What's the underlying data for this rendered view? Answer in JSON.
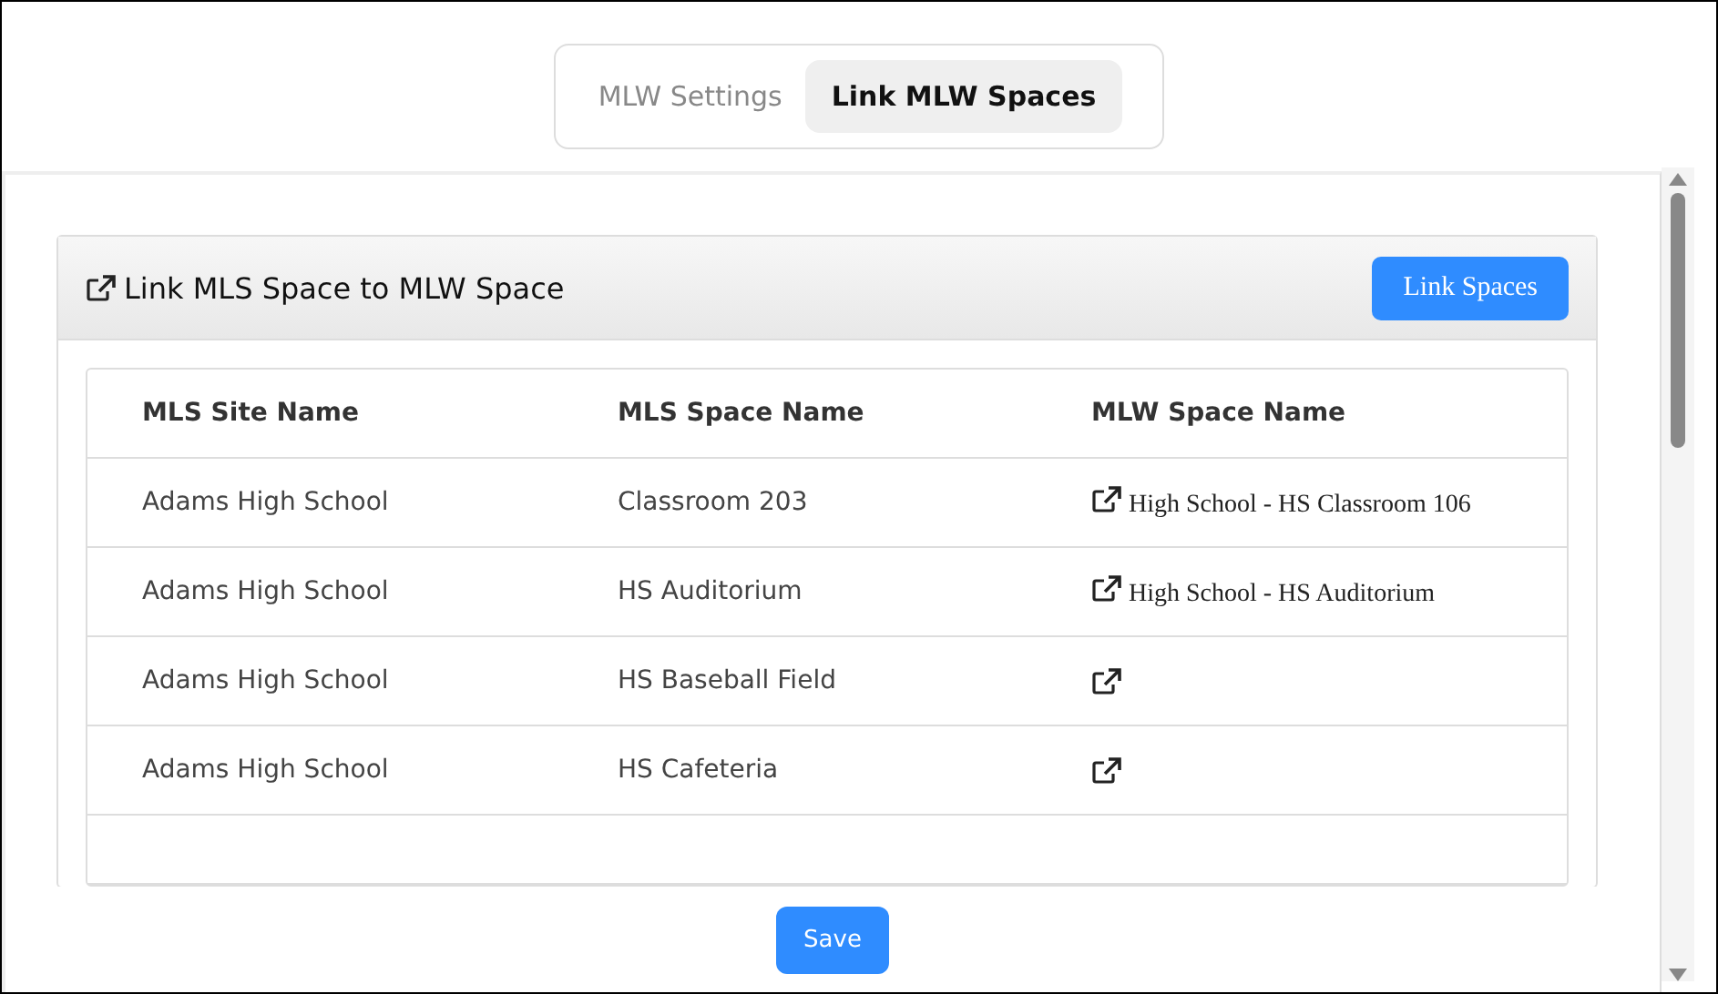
{
  "tabs": [
    {
      "label": "MLW Settings",
      "selected": false
    },
    {
      "label": "Link MLW Spaces",
      "selected": true
    }
  ],
  "card": {
    "title": "Link MLS Space to MLW Space",
    "action": "Link Spaces"
  },
  "table": {
    "columns": [
      "MLS Site Name",
      "MLS Space Name",
      "MLW Space Name"
    ],
    "rows": [
      {
        "site": "Adams High School",
        "space": "Classroom 203",
        "mlw_space": "High School - HS Classroom 106"
      },
      {
        "site": "Adams High School",
        "space": "HS Auditorium",
        "mlw_space": "High School - HS Auditorium"
      },
      {
        "site": "Adams High School",
        "space": "HS Baseball Field"
      },
      {
        "site": "Adams High School",
        "space": "HS Cafeteria"
      }
    ]
  },
  "footer": {
    "button": "Save"
  }
}
